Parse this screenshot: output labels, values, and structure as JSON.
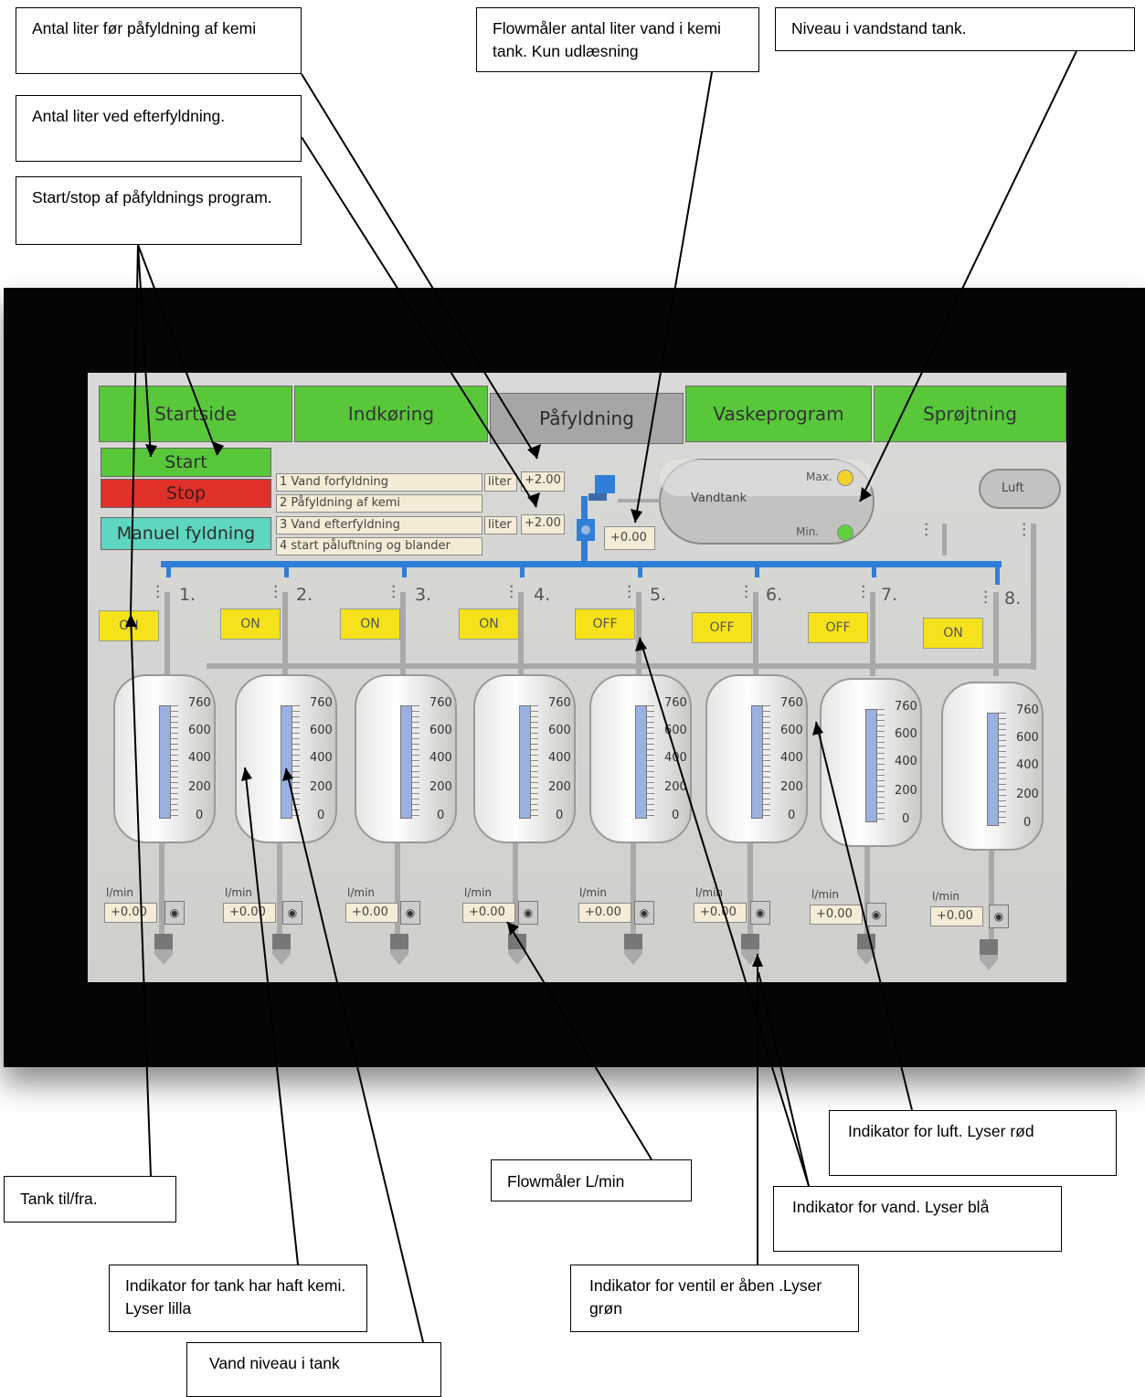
{
  "callouts": {
    "liters_before_chem": "Antal liter før påfyldning af kemi",
    "liters_refill": "Antal liter ved efterfyldning.",
    "start_stop": "Start/stop af påfyldnings program.",
    "flowmeter_chem_tank": "Flowmåler antal liter vand i kemi tank. Kun udlæsning",
    "water_level_tank": "Niveau i vandstand tank.",
    "air_indicator": "Indikator for luft. Lyser rød",
    "tank_onoff": "Tank til/fra.",
    "flowmeter_lmin": "Flowmåler L/min",
    "water_indicator": "Indikator for vand. Lyser blå",
    "chem_indicator": "Indikator for tank har haft kemi. Lyser lilla",
    "valve_indicator": "Indikator for ventil er åben .Lyser grøn",
    "tank_water_level": "Vand niveau i tank"
  },
  "tabs": [
    {
      "label": "Startside",
      "active": false
    },
    {
      "label": "Indkøring",
      "active": false
    },
    {
      "label": "Påfyldning",
      "active": true
    },
    {
      "label": "Vaskeprogram",
      "active": false
    },
    {
      "label": "Sprøjtning",
      "active": false
    }
  ],
  "controls": {
    "start": "Start",
    "stop": "Stop",
    "manual": "Manuel fyldning"
  },
  "steps": [
    "1 Vand forfyldning",
    "2 Påfyldning af kemi",
    "3 Vand efterfyldning",
    "4 start påluftning og blander"
  ],
  "step_units": {
    "unit1": "liter",
    "value1": "+2.00",
    "unit3": "liter",
    "value3": "+2.00"
  },
  "water_tank": {
    "label": "Vandtank",
    "max_label": "Max.",
    "min_label": "Min.",
    "flow_value": "+0.00",
    "air_label": "Luft",
    "max_color": "#f2d22e",
    "min_color": "#5fd13c"
  },
  "scale_labels": [
    "760",
    "600",
    "400",
    "200",
    "0"
  ],
  "tanks": [
    {
      "num": "1.",
      "state": "ON",
      "flow_unit": "l/min",
      "flow": "+0.00"
    },
    {
      "num": "2.",
      "state": "ON",
      "flow_unit": "l/min",
      "flow": "+0.00"
    },
    {
      "num": "3.",
      "state": "ON",
      "flow_unit": "l/min",
      "flow": "+0.00"
    },
    {
      "num": "4.",
      "state": "ON",
      "flow_unit": "l/min",
      "flow": "+0.00"
    },
    {
      "num": "5.",
      "state": "OFF",
      "flow_unit": "l/min",
      "flow": "+0.00"
    },
    {
      "num": "6.",
      "state": "OFF",
      "flow_unit": "l/min",
      "flow": "+0.00"
    },
    {
      "num": "7.",
      "state": "OFF",
      "flow_unit": "l/min",
      "flow": "+0.00"
    },
    {
      "num": "8.",
      "state": "ON",
      "flow_unit": "l/min",
      "flow": "+0.00"
    }
  ],
  "colors": {
    "tab_green": "#58c83a",
    "tab_active": "#a6a6a6",
    "stop_red": "#e0302a",
    "manual_teal": "#5fd6c0",
    "onoff_yellow": "#f5e21a",
    "pipe_blue": "#2f7fd8"
  }
}
